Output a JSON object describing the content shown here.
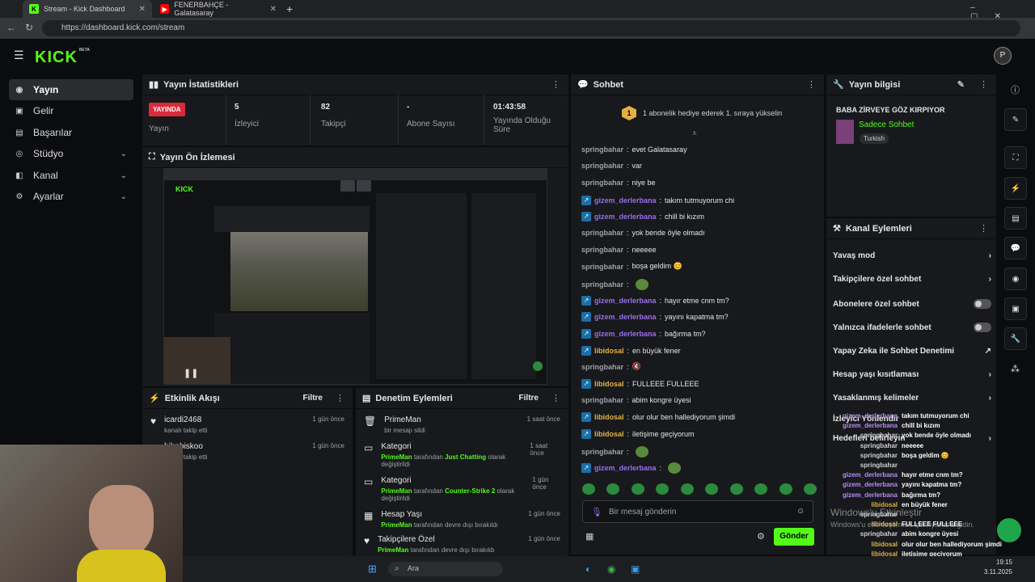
{
  "browser": {
    "tabs": [
      {
        "title": "Stream - Kick Dashboard"
      },
      {
        "title": "FENERBAHÇE - Galatasaray"
      }
    ],
    "url": "https://dashboard.kick.com/stream"
  },
  "brand": {
    "logo": "KICK",
    "beta": "BETA",
    "accent": "#53fc18"
  },
  "sidebar": {
    "items": [
      {
        "label": "Yayın",
        "icon": "broadcast-icon"
      },
      {
        "label": "Gelir",
        "icon": "revenue-icon"
      },
      {
        "label": "Başarılar",
        "icon": "achievements-icon"
      },
      {
        "label": "Stüdyo",
        "icon": "studio-icon"
      },
      {
        "label": "Kanal",
        "icon": "channel-icon"
      },
      {
        "label": "Ayarlar",
        "icon": "gear-icon"
      }
    ]
  },
  "stats": {
    "title": "Yayın İstatistikleri",
    "live_badge": "YAYINDA",
    "live_label": "Yayın",
    "viewers": "5",
    "viewers_label": "İzleyici",
    "followers": "82",
    "followers_label": "Takipçi",
    "subs": "-",
    "subs_label": "Abone Sayısı",
    "uptime": "01:43:58",
    "uptime_label": "Yayında Olduğu Süre"
  },
  "preview": {
    "title": "Yayın Ön İzlemesi"
  },
  "activity": {
    "title": "Etkinlik Akışı",
    "filter": "Filtre",
    "items": [
      {
        "user": "icardi2468",
        "sub": "kanalı takip etti",
        "time": "1 gün önce"
      },
      {
        "user": "bilrabiskoo",
        "sub": "kanalı takip etti",
        "time": "1 gün önce"
      }
    ]
  },
  "moderation": {
    "title": "Denetim Eylemleri",
    "filter": "Filtre",
    "items": [
      {
        "title": "PrimeMan",
        "sub": "bir mesajı sildi",
        "time": "1 saat önce"
      },
      {
        "title": "Kategori",
        "user": "PrimeMan",
        "mid": "tarafından",
        "val": "Just Chatting",
        "end": "olarak değiştirildi",
        "time": "1 saat önce"
      },
      {
        "title": "Kategori",
        "user": "PrimeMan",
        "mid": "tarafından",
        "val": "Counter-Strike 2",
        "end": "olarak değiştirildi",
        "time": "1 gün önce"
      },
      {
        "title": "Hesap Yaşı",
        "user": "PrimeMan",
        "end": "tarafından devre dışı bırakıldı",
        "time": "1 gün önce"
      },
      {
        "title": "Takipçilere Özel",
        "user": "PrimeMan",
        "end": "tarafından devre dışı bırakıldı",
        "time": "1 gün önce"
      }
    ]
  },
  "chat": {
    "title": "Sohbet",
    "promo": "1 abonelik hediye ederek 1. sıraya yükselin",
    "promo_num": "1",
    "messages": [
      {
        "user": "springbahar",
        "text": "evet Galatasaray",
        "c": "g"
      },
      {
        "user": "springbahar",
        "text": "var",
        "c": "g"
      },
      {
        "user": "springbahar",
        "text": "niye be",
        "c": "g"
      },
      {
        "user": "gizem_derlerbana",
        "text": "takım tutmuyorum chi",
        "c": "p"
      },
      {
        "user": "gizem_derlerbana",
        "text": "chill bi kızım",
        "c": "p"
      },
      {
        "user": "springbahar",
        "text": "yok bende öyle olmadı",
        "c": "g"
      },
      {
        "user": "springbahar",
        "text": "neeeee",
        "c": "g"
      },
      {
        "user": "springbahar",
        "text": "boşa geldim 😊",
        "c": "g"
      },
      {
        "user": "springbahar",
        "text": "",
        "c": "g"
      },
      {
        "user": "gizem_derlerbana",
        "text": "hayır etme cnm tm?",
        "c": "p"
      },
      {
        "user": "gizem_derlerbana",
        "text": "yayını kapatma tm?",
        "c": "p"
      },
      {
        "user": "gizem_derlerbana",
        "text": "bağırma tm?",
        "c": "p"
      },
      {
        "user": "libidosal",
        "text": "en büyük fener",
        "c": "o"
      },
      {
        "user": "springbahar",
        "text": "🔇",
        "c": "g"
      },
      {
        "user": "libidosal",
        "text": "FULLEEE FULLEEE",
        "c": "o"
      },
      {
        "user": "springbahar",
        "text": "abim kongre üyesi",
        "c": "g"
      },
      {
        "user": "libidosal",
        "text": "olur olur ben hallediyorum şimdi",
        "c": "o"
      },
      {
        "user": "libidosal",
        "text": "iletişime geçiyorum",
        "c": "o"
      },
      {
        "user": "springbahar",
        "text": "",
        "c": "g"
      },
      {
        "user": "gizem_derlerbana",
        "text": "",
        "c": "p"
      }
    ],
    "input_placeholder": "Bir mesaj gönderin",
    "send": "Gönder"
  },
  "stream_info": {
    "title": "Yayın bilgisi",
    "stream_title": "BABA ZİRVEYE GÖZ KIRPIYOR",
    "category": "Sadece Sohbet",
    "language": "Turkish"
  },
  "channel_actions": {
    "title": "Kanal Eylemleri",
    "items": [
      {
        "label": "Yavaş mod",
        "ctl": "chevron"
      },
      {
        "label": "Takipçilere özel sohbet",
        "ctl": "chevron"
      },
      {
        "label": "Abonelere özel sohbet",
        "ctl": "toggle"
      },
      {
        "label": "Yalnızca ifadelerle sohbet",
        "ctl": "toggle"
      },
      {
        "label": "Yapay Zeka ile Sohbet Denetimi",
        "ctl": "external"
      },
      {
        "label": "Hesap yaşı kısıtlaması",
        "ctl": "chevron"
      },
      {
        "label": "Yasaklanmış kelimeler",
        "ctl": "chevron"
      },
      {
        "label": "İzleyici Yönlendir",
        "ctl": "none"
      },
      {
        "label": "Hedefleri belirleyin",
        "ctl": "chevron"
      }
    ]
  },
  "overlay_chat": [
    {
      "user": "gizem_derlerbana",
      "text": "takım tutmuyorum chi"
    },
    {
      "user": "gizem_derlerbana",
      "text": "chill bi kızım"
    },
    {
      "user": "springbahar",
      "text": "yok bende öyle olmadı"
    },
    {
      "user": "springbahar",
      "text": "neeeee"
    },
    {
      "user": "springbahar",
      "text": "boşa geldim 😊"
    },
    {
      "user": "springbahar",
      "text": ""
    },
    {
      "user": "gizem_derlerbana",
      "text": "hayır etme cnm tm?"
    },
    {
      "user": "gizem_derlerbana",
      "text": "yayını kapatma tm?"
    },
    {
      "user": "gizem_derlerbana",
      "text": "bağırma tm?"
    },
    {
      "user": "libidosal",
      "text": "en büyük fener"
    },
    {
      "user": "springbahar",
      "text": ""
    },
    {
      "user": "libidosal",
      "text": "FULLEEE FULLEEE"
    },
    {
      "user": "springbahar",
      "text": "abim kongre üyesi"
    },
    {
      "user": "libidosal",
      "text": "olur olur ben hallediyorum şimdi"
    },
    {
      "user": "libidosal",
      "text": "iletişime geçiyorum"
    }
  ],
  "windows": {
    "watermark1": "Windows'u Etkinleştir",
    "watermark2": "Windows'u etkinleştirmek için Ayarlar'a gidin.",
    "search": "Ara",
    "time": "19:15",
    "date": "3.11.2025"
  }
}
